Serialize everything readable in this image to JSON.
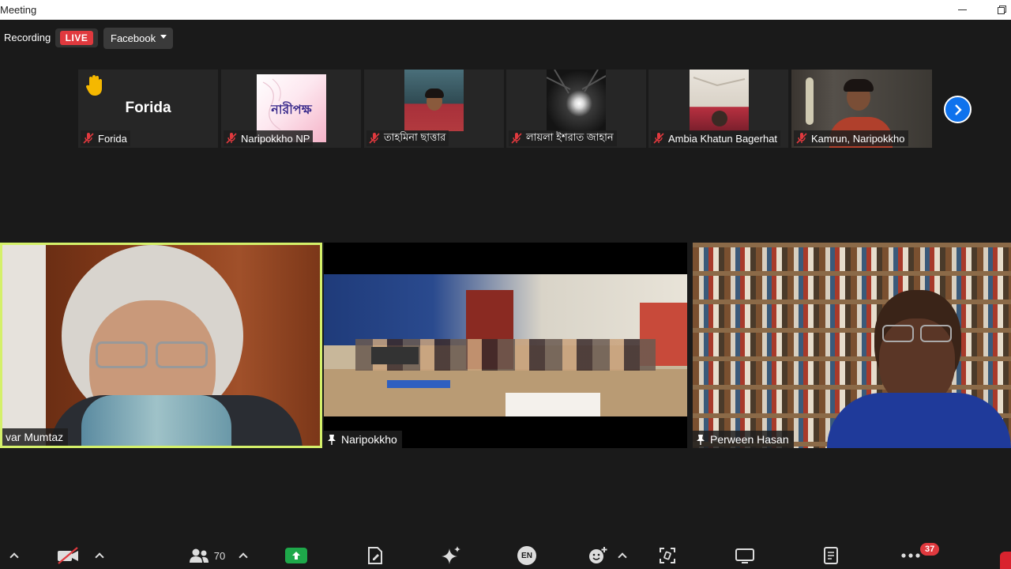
{
  "window": {
    "title": "Meeting"
  },
  "recording": {
    "label": "Recording",
    "live_badge": "LIVE",
    "destination": "Facebook"
  },
  "thumbnails": [
    {
      "name": "Forida",
      "initials": "Forida",
      "muted": true,
      "hand_raised": true
    },
    {
      "name": "Naripokkho NP",
      "logo_text": "নারীপক্ষ",
      "muted": true
    },
    {
      "name": "তাহমিনা ছাত্তার",
      "muted": true
    },
    {
      "name": "লায়লা ইশরাত জাহান",
      "muted": true
    },
    {
      "name": "Ambia Khatun Bagerhat",
      "muted": true
    },
    {
      "name": "Kamrun, Naripokkho",
      "muted": true
    }
  ],
  "main_tiles": [
    {
      "name": "var Mumtaz",
      "active_speaker": true,
      "pinned": false
    },
    {
      "name": "Naripokkho",
      "active_speaker": false,
      "pinned": true
    },
    {
      "name": "Perween Hasan",
      "active_speaker": false,
      "pinned": true
    }
  ],
  "toolbar": {
    "participants_count": "70",
    "language": "EN",
    "more_badge": "37"
  },
  "colors": {
    "live": "#e0393e",
    "active_speaker_border": "#d4f06a",
    "share_green": "#1ea84a",
    "next_button": "#0e72ed",
    "badge_red": "#e0393e"
  }
}
